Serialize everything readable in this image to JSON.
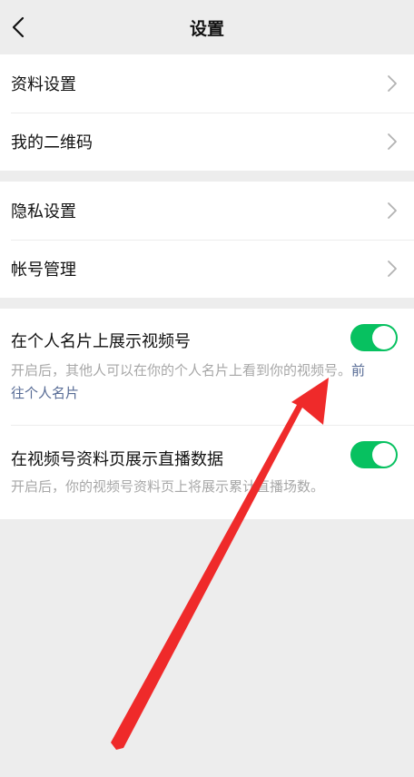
{
  "header": {
    "title": "设置",
    "back_icon": "chevron-left-icon"
  },
  "group1": {
    "items": [
      {
        "label": "资料设置"
      },
      {
        "label": "我的二维码"
      }
    ]
  },
  "group2": {
    "items": [
      {
        "label": "隐私设置"
      },
      {
        "label": "帐号管理"
      }
    ]
  },
  "group3": {
    "toggle1": {
      "title": "在个人名片上展示视频号",
      "desc_line1": "开启后，其他人可以在你的个人名片上看到你的视频号。",
      "link1": "前",
      "link2": "往个人名片",
      "state": "on"
    },
    "toggle2": {
      "title": "在视频号资料页展示直播数据",
      "desc": "开启后，你的视频号资料页上将展示累计直播场数。",
      "state": "on"
    }
  },
  "colors": {
    "background": "#ededed",
    "card": "#ffffff",
    "switch_on": "#07c160",
    "link": "#576b95",
    "muted_text": "#a7a7a7",
    "annotation_arrow": "#ef2a2a"
  }
}
